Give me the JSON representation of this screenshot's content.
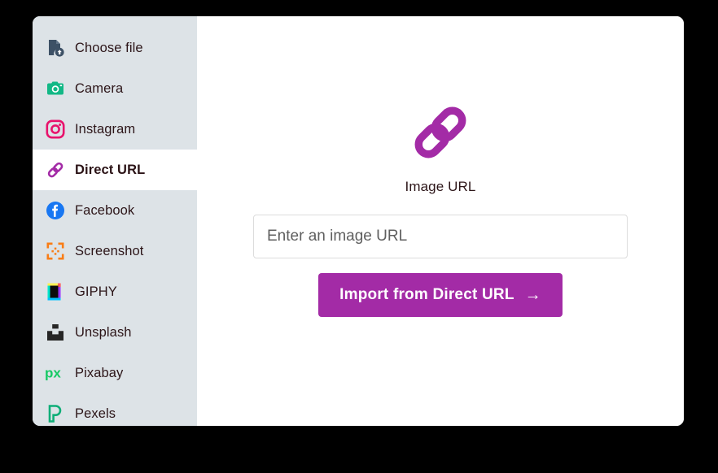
{
  "theme": {
    "page_background": "#000000",
    "card_background": "#ffffff",
    "sidebar_background": "#dde3e7",
    "accent_purple": "#a32ba6",
    "text_color": "#2c1518",
    "input_border": "#dcdcdc",
    "placeholder_color": "#5f5f5f"
  },
  "sidebar": {
    "items": [
      {
        "label": "Choose file",
        "icon": "document-upload-icon",
        "active": false
      },
      {
        "label": "Camera",
        "icon": "camera-icon",
        "active": false
      },
      {
        "label": "Instagram",
        "icon": "instagram-icon",
        "active": false
      },
      {
        "label": "Direct URL",
        "icon": "link-chain-icon",
        "active": true
      },
      {
        "label": "Facebook",
        "icon": "facebook-icon",
        "active": false
      },
      {
        "label": "Screenshot",
        "icon": "screen-capture-icon",
        "active": false
      },
      {
        "label": "GIPHY",
        "icon": "giphy-icon",
        "active": false
      },
      {
        "label": "Unsplash",
        "icon": "unsplash-icon",
        "active": false
      },
      {
        "label": "Pixabay",
        "icon": "pixabay-icon",
        "active": false
      },
      {
        "label": "Pexels",
        "icon": "pexels-icon",
        "active": false
      }
    ]
  },
  "main": {
    "hero_icon": "link-chain-icon",
    "title": "Image URL",
    "input": {
      "placeholder": "Enter an image URL",
      "value": ""
    },
    "import_button": {
      "label": "Import from Direct URL",
      "arrow": "→"
    }
  }
}
